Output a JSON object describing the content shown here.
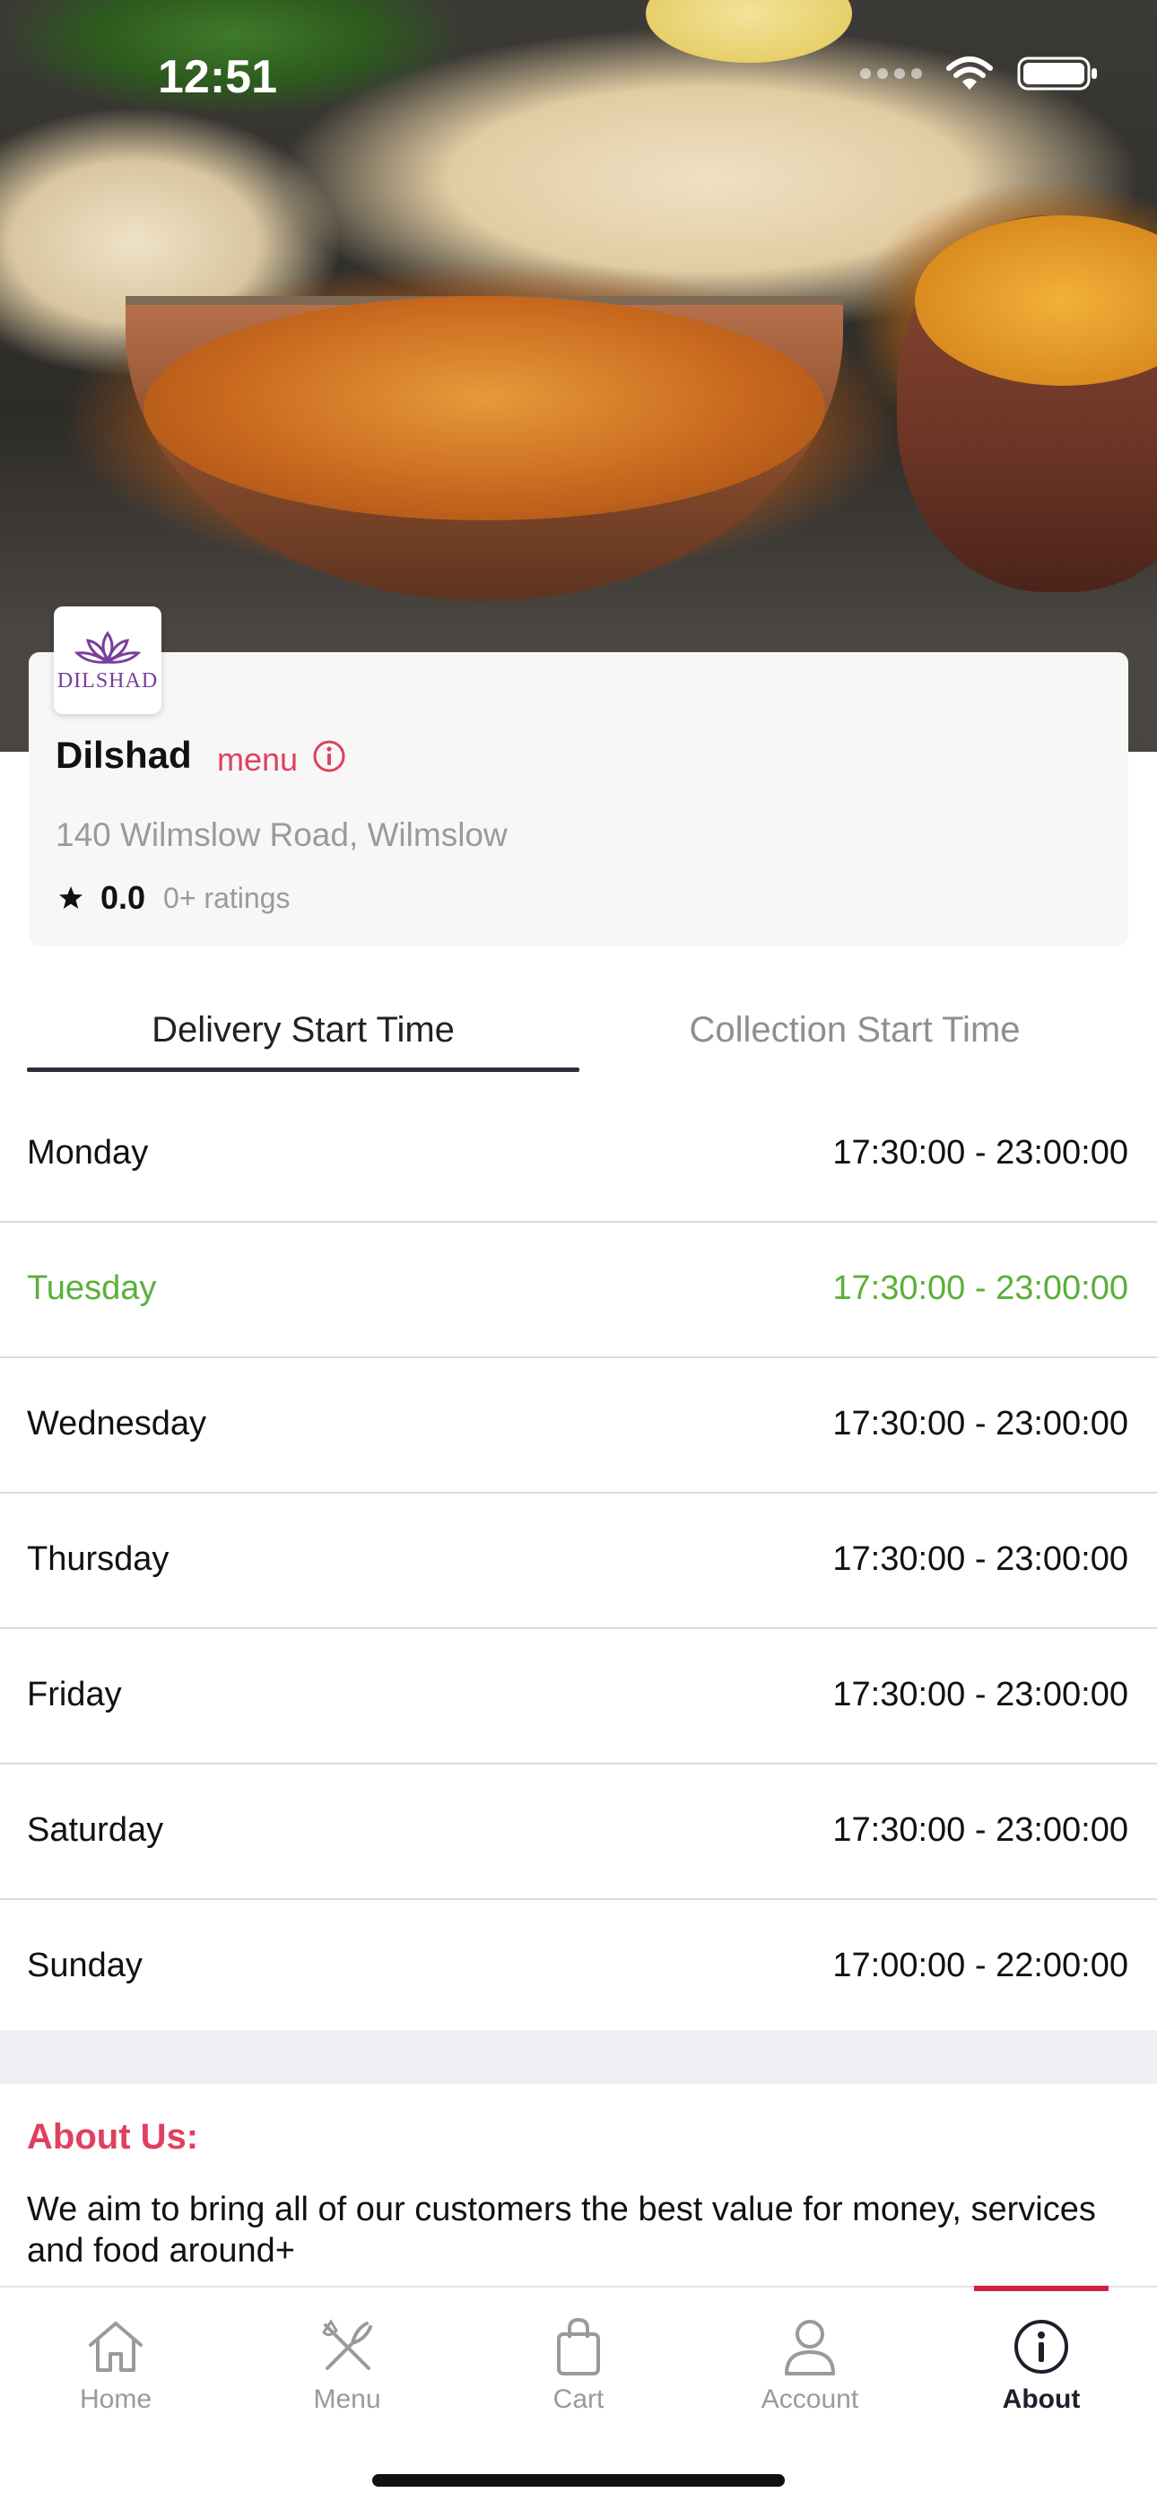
{
  "status_bar": {
    "time": "12:51"
  },
  "restaurant": {
    "logo_text": "DILSHAD",
    "name": "Dilshad",
    "menu_label": "menu",
    "address": "140 Wilmslow Road, Wilmslow",
    "rating": "0.0",
    "rating_count": "0+ ratings"
  },
  "tabs": [
    {
      "label": "Delivery Start Time",
      "active": true
    },
    {
      "label": "Collection Start Time",
      "active": false
    }
  ],
  "hours": [
    {
      "day": "Monday",
      "time": "17:30:00 - 23:00:00"
    },
    {
      "day": "Tuesday",
      "time": "17:30:00 - 23:00:00",
      "highlight": true
    },
    {
      "day": "Wednesday",
      "time": "17:30:00 - 23:00:00"
    },
    {
      "day": "Thursday",
      "time": "17:30:00 - 23:00:00"
    },
    {
      "day": "Friday",
      "time": "17:30:00 - 23:00:00"
    },
    {
      "day": "Saturday",
      "time": "17:30:00 - 23:00:00"
    },
    {
      "day": "Sunday",
      "time": "17:00:00 - 22:00:00"
    }
  ],
  "about": {
    "title": "About Us:",
    "text": "We aim to bring all of our customers the best value for money, services and food around+"
  },
  "tabbar": [
    {
      "label": "Home",
      "icon": "home-icon"
    },
    {
      "label": "Menu",
      "icon": "fork-knife-icon"
    },
    {
      "label": "Cart",
      "icon": "shopping-bag-icon"
    },
    {
      "label": "Account",
      "icon": "person-icon"
    },
    {
      "label": "About",
      "icon": "info-icon",
      "active": true
    }
  ],
  "colors": {
    "accent": "#e0405e",
    "today": "#5bb038",
    "active_tab_bar": "#d21f3c"
  }
}
